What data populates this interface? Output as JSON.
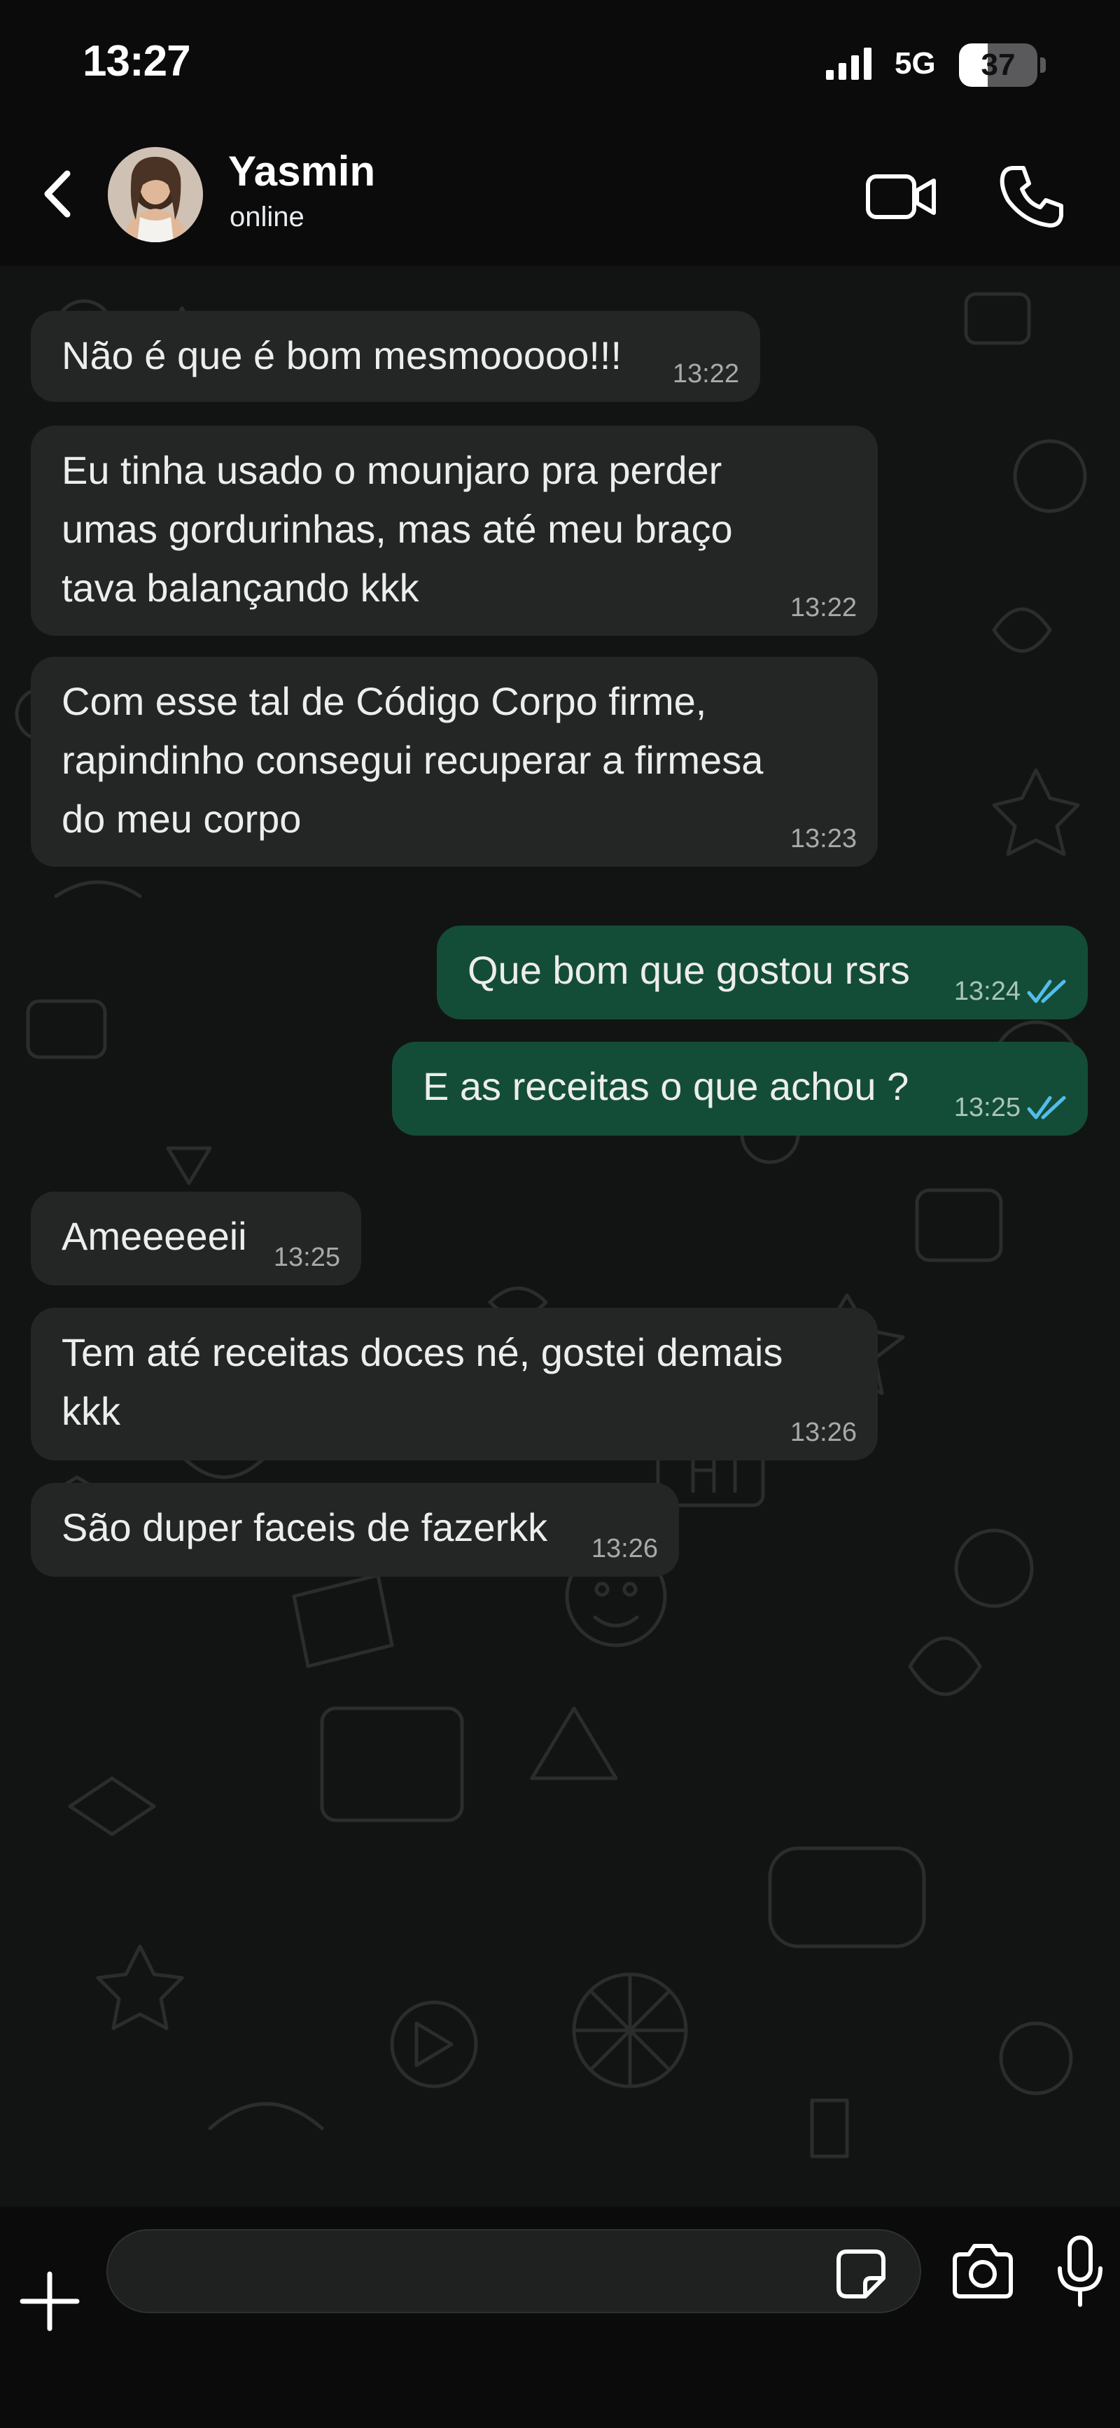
{
  "status_bar": {
    "time": "13:27",
    "network": "5G",
    "battery_level": "37",
    "battery_fraction": 0.37
  },
  "header": {
    "contact_name": "Yasmin",
    "contact_status": "online"
  },
  "messages": [
    {
      "direction": "in",
      "text": "Não é que é bom mesmooooo!!!",
      "time": "13:22"
    },
    {
      "direction": "in",
      "text": "Eu tinha usado o mounjaro pra perder\numas gordurinhas, mas até meu braço\ntava balançando kkk",
      "time": "13:22"
    },
    {
      "direction": "in",
      "text": "Com esse tal de Código Corpo firme,\nrapindinho consegui recuperar a firmesa\ndo meu corpo",
      "time": "13:23"
    },
    {
      "direction": "out",
      "text": "Que bom que gostou rsrs",
      "time": "13:24",
      "status": "read"
    },
    {
      "direction": "out",
      "text": "E as receitas o que achou ?",
      "time": "13:25",
      "status": "read"
    },
    {
      "direction": "in",
      "text": "Ameeeeeii",
      "time": "13:25"
    },
    {
      "direction": "in",
      "text": "Tem até receitas doces né, gostei demais\nkkk",
      "time": "13:26"
    },
    {
      "direction": "in",
      "text": "São duper faceis de fazerkk",
      "time": "13:26"
    }
  ],
  "input": {
    "value": "",
    "placeholder": ""
  },
  "icons": {
    "back": "chevron-left-icon",
    "video_call": "video-camera-icon",
    "voice_call": "phone-icon",
    "add": "plus-icon",
    "sticker": "sticker-icon",
    "camera": "camera-icon",
    "mic": "microphone-icon",
    "read_receipt": "double-check-icon"
  },
  "colors": {
    "incoming_bubble": "#242626",
    "outgoing_bubble": "#144d37",
    "read_receipt": "#53bdeb",
    "background": "#0b0b0c"
  }
}
